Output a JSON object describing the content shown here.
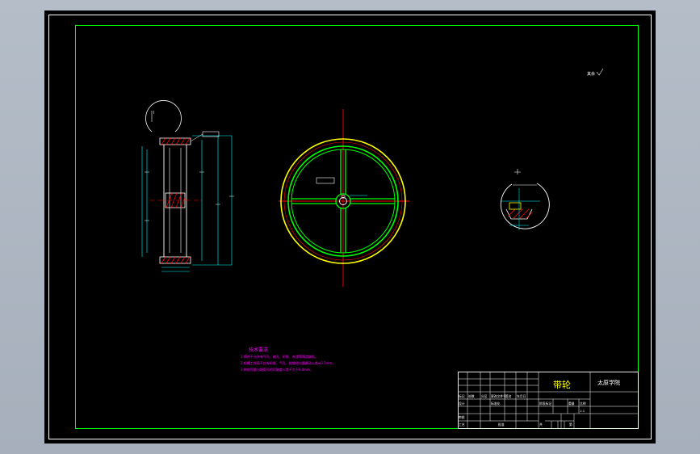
{
  "colors": {
    "border": "#ffffff",
    "frame": "#00ff00",
    "rim": "#ffff00",
    "center_line": "#ff0000",
    "hatch": "#ff0000",
    "dimension": "#00ffff",
    "notes": "#ff00ff"
  },
  "drawing": {
    "corner_note": "其余",
    "detail_label": "I"
  },
  "notes": {
    "heading": "技术要求",
    "lines": [
      "1.铸件不允许有气孔、缩孔、砂眼、夹渣等铸造缺陷。",
      "2.轮槽工作面不应有砂眼、气孔，轮缘径向圆跳动公差≤0.5mm。",
      "3.带轮外圆与轮毂孔的同轴度公差不大于0.4mm。"
    ]
  },
  "title_block": {
    "part_name": "带轮",
    "school": "太原学院",
    "row_header": [
      "标记",
      "处数",
      "分区",
      "更改文件号",
      "签名",
      "年月日"
    ],
    "design_label": "设计",
    "standardize_label": "标准化",
    "review_label": "审核",
    "process_label": "工艺",
    "approve_label": "批准",
    "stage_label": "阶段标记",
    "weight_label": "重量",
    "scale_label": "比例",
    "scale_value": "1:1",
    "sheet_label": "共",
    "sheet_of_label": "第"
  }
}
